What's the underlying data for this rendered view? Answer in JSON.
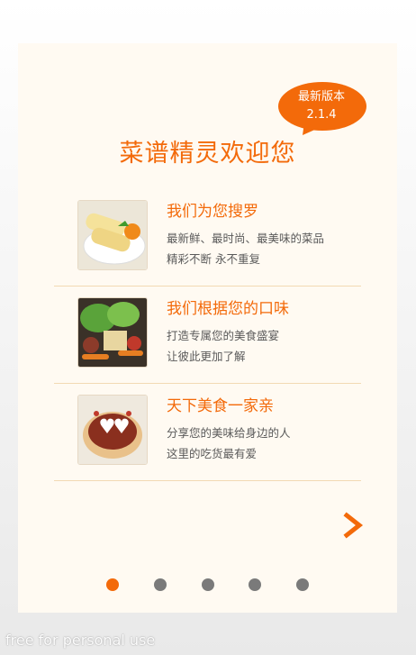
{
  "version_badge": {
    "line1": "最新版本",
    "line2": "2.1.4"
  },
  "welcome_title": "菜谱精灵欢迎您",
  "features": [
    {
      "title": "我们为您搜罗",
      "line1": "最新鲜、最时尚、最美味的菜品",
      "line2": "精彩不断  永不重复"
    },
    {
      "title": "我们根据您的口味",
      "line1": "打造专属您的美食盛宴",
      "line2": "让彼此更加了解"
    },
    {
      "title": "天下美食一家亲",
      "line1": "分享您的美味给身边的人",
      "line2": "这里的吃货最有爱"
    }
  ],
  "pager": {
    "count": 5,
    "active_index": 0
  },
  "watermark": "free for personal use",
  "colors": {
    "accent": "#f36a0a",
    "card_bg": "#fffaf2",
    "dot_inactive": "#7a7a7a",
    "separator": "#f2d9b3"
  },
  "icons": {
    "next": "chevron-right-icon"
  }
}
